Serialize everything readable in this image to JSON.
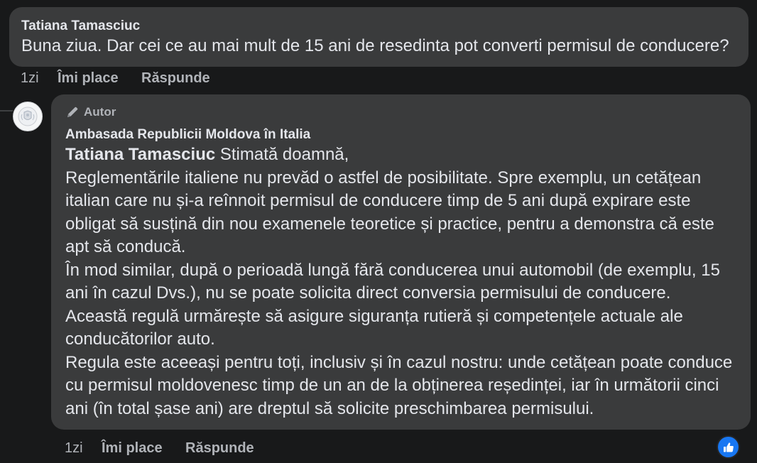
{
  "comment1": {
    "author": "Tatiana Tamasciuc",
    "text": "Buna ziua. Dar cei ce au mai mult de 15 ani de resedinta pot converti permisul de conducere?",
    "time": "1zi",
    "like_label": "Îmi place",
    "reply_label": "Răspunde"
  },
  "reply": {
    "badge": "Autor",
    "page_name": "Ambasada Republicii Moldova în Italia",
    "mention": "Tatiana Tamasciuc",
    "first_line_rest": " Stimată doamnă,",
    "lines": [
      "Reglementările italiene nu prevăd o astfel de posibilitate. Spre exemplu, un cetățean",
      "italian care nu și-a reînnoit permisul de conducere timp de 5 ani după expirare este",
      "obligat să susțină din nou examenele teoretice și practice, pentru a demonstra că este",
      "apt să conducă.",
      "În mod similar, după o perioadă lungă fără conducerea unui automobil (de exemplu, 15",
      "ani în cazul Dvs.), nu se poate solicita direct conversia permisului de conducere.",
      "Această regulă urmărește să asigure siguranța rutieră și competențele actuale ale",
      "conducătorilor auto.",
      "Regula este aceeași pentru toți, inclusiv și în cazul nostru: unde cetățean poate conduce",
      "cu permisul moldovenesc timp de un an de la obținerea reședinței, iar în următorii cinci",
      "ani (în total șase ani) are dreptul să solicite preschimbarea permisului."
    ],
    "time": "1zi",
    "like_label": "Îmi place",
    "reply_label": "Răspunde",
    "reaction_icon": "thumbs-up-icon",
    "reaction_color": "#1877f2"
  },
  "colors": {
    "background": "#18191a",
    "bubble": "#3a3b3c",
    "text": "#e4e6eb",
    "secondary_text": "#b0b3b8"
  }
}
